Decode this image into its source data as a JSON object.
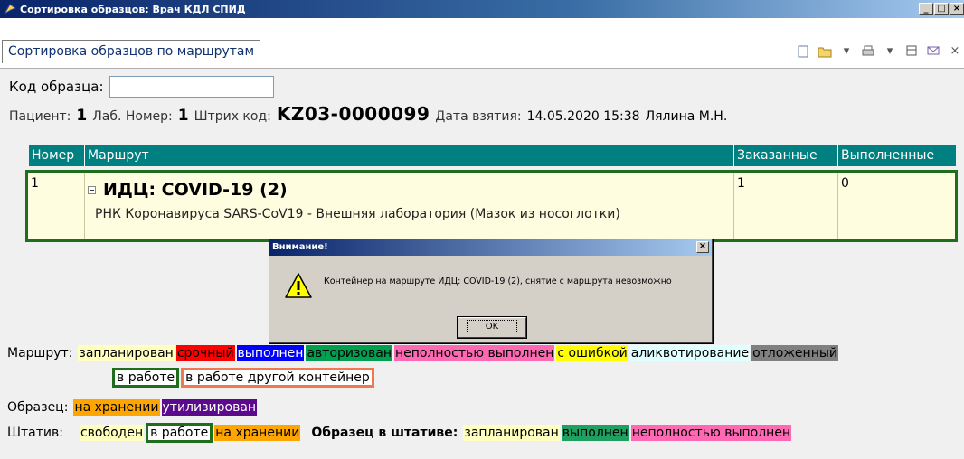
{
  "window": {
    "title": "Сортировка образцов: Врач КДЛ СПИД",
    "min": "_",
    "max": "□",
    "close": "×"
  },
  "tab": {
    "label": "Сортировка образцов по маршрутам"
  },
  "search": {
    "label": "Код образца:",
    "value": ""
  },
  "patient": {
    "patient_label": "Пациент:",
    "patient_value": "1",
    "lab_label": "Лаб. Номер:",
    "lab_value": "1",
    "barcode_label": "Штрих код:",
    "barcode_value": "KZ03-0000099",
    "date_label": "Дата взятия:",
    "date_value": "14.05.2020 15:38",
    "doctor": "Лялина М.Н."
  },
  "grid": {
    "columns": [
      "Номер",
      "Маршрут",
      "Заказанные",
      "Выполненные"
    ],
    "row": {
      "num": "1",
      "route": "ИДЦ: COVID-19 (2)",
      "sub": "РНК Коронавируса SARS-CoV19 - Внешняя лаборатория (Мазок из носоглотки)",
      "ordered": "1",
      "done": "0"
    }
  },
  "dialog": {
    "title": "Внимание!",
    "message": "Контейнер на маршруте ИДЦ: COVID-19 (2), снятие с маршрута невозможно",
    "ok": "OK",
    "close": "×"
  },
  "legend": {
    "route_label": "Маршрут:",
    "route_chips": [
      {
        "text": "запланирован",
        "bg": "#ffffc0",
        "fg": "#000000"
      },
      {
        "text": "срочный",
        "bg": "#ff0000",
        "fg": "#000000"
      },
      {
        "text": "выполнен",
        "bg": "#0000ff",
        "fg": "#ffffff"
      },
      {
        "text": "авторизован",
        "bg": "#00a050",
        "fg": "#000000"
      },
      {
        "text": "неполностью выполнен",
        "bg": "#ff69b4",
        "fg": "#000000"
      },
      {
        "text": "с ошибкой",
        "bg": "#ffff00",
        "fg": "#000000"
      },
      {
        "text": "аликвотирование",
        "bg": "#e0ffff",
        "fg": "#000000"
      },
      {
        "text": "отложенный",
        "bg": "#808080",
        "fg": "#000000"
      }
    ],
    "route_chips_2": [
      {
        "text": "в работе",
        "bg": "#ffffff",
        "fg": "#000000",
        "box": "green"
      },
      {
        "text": "в работе другой контейнер",
        "bg": "#ffffff",
        "fg": "#000000",
        "box": "orange"
      }
    ],
    "sample_label": "Образец:",
    "sample_chips": [
      {
        "text": "на хранении",
        "bg": "#ffa500",
        "fg": "#000000"
      },
      {
        "text": "утилизирован",
        "bg": "#5a0a8a",
        "fg": "#ffffff"
      }
    ],
    "rack_label": "Штатив:",
    "rack_chips": [
      {
        "text": "свободен",
        "bg": "#ffffc0",
        "fg": "#000000"
      },
      {
        "text": "в работе",
        "bg": "#ffffff",
        "fg": "#000000",
        "box": "green"
      },
      {
        "text": "на хранении",
        "bg": "#ffa500",
        "fg": "#000000"
      }
    ],
    "rack_sample_label": "Образец в штативе:",
    "rack_sample_chips": [
      {
        "text": "запланирован",
        "bg": "#ffffc0",
        "fg": "#000000"
      },
      {
        "text": "выполнен",
        "bg": "#20a060",
        "fg": "#000000"
      },
      {
        "text": "неполностью выполнен",
        "bg": "#ff69b4",
        "fg": "#000000"
      }
    ]
  }
}
